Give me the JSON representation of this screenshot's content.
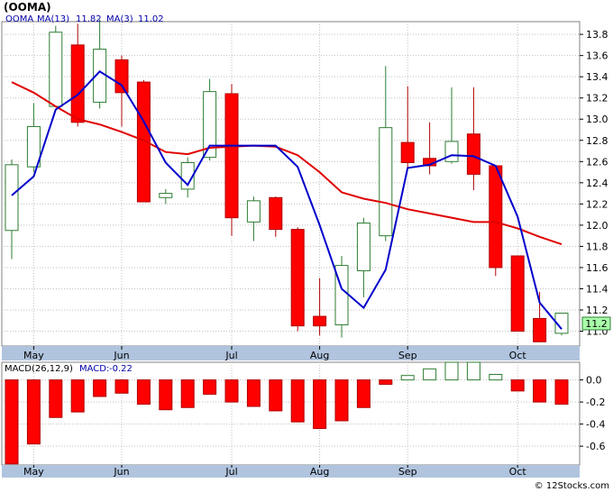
{
  "header": {
    "symbol_label": "(OOMA)",
    "credit": "© 12Stocks.com"
  },
  "colors": {
    "up_candle_fill": "#ffffff",
    "up_candle_stroke": "#2e7d32",
    "down_candle_fill": "#ff0000",
    "down_candle_stroke": "#b00000",
    "ma13_line": "#e00000",
    "ma3_line": "#0000cc",
    "macd_positive_stroke": "#2e7d32",
    "macd_negative_fill": "#ff0000",
    "last_price_tag_fill": "#aaffaa",
    "axis_band_fill": "#b0c4de",
    "legend_text": "#0000aa",
    "grid": "#c0c0c0"
  },
  "chart_data": [
    {
      "type": "candlestick",
      "legend": [
        {
          "label": "OOMA",
          "color": "#0000aa"
        },
        {
          "label": "MA(13)",
          "value": "11.82",
          "color": "#0000aa"
        },
        {
          "label": "MA(3)",
          "value": "11.02",
          "color": "#0000aa"
        }
      ],
      "x_labels": [
        "May",
        "Jun",
        "Jul",
        "Aug",
        "Sep",
        "Oct"
      ],
      "x_label_week_index": [
        1,
        5,
        10,
        14,
        18,
        23
      ],
      "y_ticks": [
        "11.0",
        "11.2",
        "11.4",
        "11.6",
        "11.8",
        "12.0",
        "12.2",
        "12.4",
        "12.6",
        "12.8",
        "13.0",
        "13.2",
        "13.4",
        "13.6",
        "13.8"
      ],
      "ylim": [
        10.86,
        13.92
      ],
      "grid": true,
      "last_price": "11.2",
      "candles": [
        {
          "o": 11.95,
          "h": 12.62,
          "l": 11.68,
          "c": 12.57
        },
        {
          "o": 12.55,
          "h": 13.15,
          "l": 12.5,
          "c": 12.93
        },
        {
          "o": 13.12,
          "h": 13.88,
          "l": 13.12,
          "c": 13.82
        },
        {
          "o": 13.7,
          "h": 13.9,
          "l": 12.93,
          "c": 12.97
        },
        {
          "o": 13.16,
          "h": 13.94,
          "l": 13.1,
          "c": 13.66
        },
        {
          "o": 13.56,
          "h": 13.6,
          "l": 12.93,
          "c": 13.25
        },
        {
          "o": 13.35,
          "h": 13.37,
          "l": 12.22,
          "c": 12.22
        },
        {
          "o": 12.26,
          "h": 12.34,
          "l": 12.2,
          "c": 12.3
        },
        {
          "o": 12.34,
          "h": 12.64,
          "l": 12.26,
          "c": 12.59
        },
        {
          "o": 12.64,
          "h": 13.38,
          "l": 12.61,
          "c": 13.26
        },
        {
          "o": 13.24,
          "h": 13.33,
          "l": 11.9,
          "c": 12.07
        },
        {
          "o": 12.03,
          "h": 12.27,
          "l": 11.85,
          "c": 12.23
        },
        {
          "o": 12.26,
          "h": 12.27,
          "l": 11.89,
          "c": 11.96
        },
        {
          "o": 11.96,
          "h": 11.98,
          "l": 11.0,
          "c": 11.05
        },
        {
          "o": 11.14,
          "h": 11.5,
          "l": 10.96,
          "c": 11.05
        },
        {
          "o": 11.06,
          "h": 11.71,
          "l": 10.94,
          "c": 11.62
        },
        {
          "o": 11.57,
          "h": 12.07,
          "l": 11.32,
          "c": 12.02
        },
        {
          "o": 11.9,
          "h": 13.5,
          "l": 11.85,
          "c": 12.92
        },
        {
          "o": 12.78,
          "h": 13.31,
          "l": 12.53,
          "c": 12.59
        },
        {
          "o": 12.63,
          "h": 12.97,
          "l": 12.48,
          "c": 12.56
        },
        {
          "o": 12.6,
          "h": 13.3,
          "l": 12.58,
          "c": 12.79
        },
        {
          "o": 12.86,
          "h": 13.3,
          "l": 12.33,
          "c": 12.48
        },
        {
          "o": 12.56,
          "h": 12.56,
          "l": 11.52,
          "c": 11.6
        },
        {
          "o": 11.71,
          "h": 11.71,
          "l": 11.0,
          "c": 11.0
        },
        {
          "o": 11.12,
          "h": 11.37,
          "l": 10.9,
          "c": 10.9
        },
        {
          "o": 10.98,
          "h": 11.17,
          "l": 10.96,
          "c": 11.17
        }
      ],
      "series": [
        {
          "name": "MA(13)",
          "start_index": 0,
          "values": [
            13.35,
            13.25,
            13.12,
            13.0,
            12.95,
            12.88,
            12.8,
            12.69,
            12.67,
            12.73,
            12.74,
            12.75,
            12.74,
            12.66,
            12.5,
            12.31,
            12.25,
            12.21,
            12.15,
            12.11,
            12.07,
            12.03,
            12.03,
            11.97,
            11.89,
            11.82
          ]
        },
        {
          "name": "MA(3)",
          "start_index": 0,
          "values": [
            12.28,
            12.46,
            13.09,
            13.23,
            13.45,
            13.32,
            12.98,
            12.59,
            12.38,
            12.75,
            12.75,
            12.75,
            12.75,
            12.55,
            12.0,
            11.4,
            11.22,
            11.58,
            12.54,
            12.57,
            12.66,
            12.65,
            12.56,
            12.08,
            11.27,
            11.02
          ]
        }
      ]
    },
    {
      "type": "bar",
      "legend": [
        {
          "label": "MACD(26,12,9)",
          "color": "#000000"
        },
        {
          "label": "MACD:",
          "value": "-0.22",
          "color": "#0000aa"
        }
      ],
      "x_labels": [
        "May",
        "Jun",
        "Jul",
        "Aug",
        "Sep",
        "Oct"
      ],
      "y_ticks": [
        "-0.6",
        "-0.4",
        "-0.2",
        "0.0"
      ],
      "ylim": [
        -0.77,
        0.16
      ],
      "grid": true,
      "values": [
        -0.76,
        -0.58,
        -0.34,
        -0.29,
        -0.15,
        -0.12,
        -0.22,
        -0.27,
        -0.25,
        -0.13,
        -0.2,
        -0.24,
        -0.28,
        -0.38,
        -0.44,
        -0.37,
        -0.25,
        -0.04,
        0.04,
        0.1,
        0.16,
        0.16,
        0.05,
        -0.1,
        -0.2,
        -0.22
      ]
    }
  ]
}
